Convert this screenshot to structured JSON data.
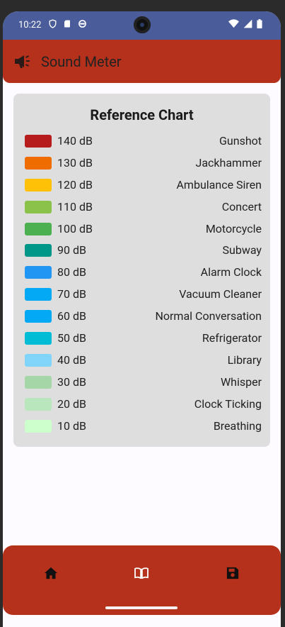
{
  "status": {
    "time": "10:22"
  },
  "app": {
    "title": "Sound Meter",
    "title_icon": "megaphone-icon"
  },
  "reference_chart": {
    "title": "Reference Chart",
    "items": [
      {
        "db": "140 dB",
        "source": "Gunshot",
        "color": "#b71c1c"
      },
      {
        "db": "130 dB",
        "source": "Jackhammer",
        "color": "#ef6c00"
      },
      {
        "db": "120 dB",
        "source": "Ambulance Siren",
        "color": "#ffc107"
      },
      {
        "db": "110 dB",
        "source": "Concert",
        "color": "#8bc34a"
      },
      {
        "db": "100 dB",
        "source": "Motorcycle",
        "color": "#4caf50"
      },
      {
        "db": "90 dB",
        "source": "Subway",
        "color": "#009688"
      },
      {
        "db": "80 dB",
        "source": "Alarm Clock",
        "color": "#2196f3"
      },
      {
        "db": "70 dB",
        "source": "Vacuum Cleaner",
        "color": "#03a9f4"
      },
      {
        "db": "60 dB",
        "source": "Normal Conversation",
        "color": "#03a9f4"
      },
      {
        "db": "50 dB",
        "source": "Refrigerator",
        "color": "#00bcd4"
      },
      {
        "db": "40 dB",
        "source": "Library",
        "color": "#81d4fa"
      },
      {
        "db": "30 dB",
        "source": "Whisper",
        "color": "#a5d6a7"
      },
      {
        "db": "20 dB",
        "source": "Clock Ticking",
        "color": "#b9e6bd"
      },
      {
        "db": "10 dB",
        "source": "Breathing",
        "color": "#ccffcc"
      }
    ]
  },
  "bottom_nav": {
    "items": [
      "home-icon",
      "book-icon",
      "save-icon"
    ]
  },
  "colors": {
    "status_bar": "#4a5d9a",
    "primary": "#b5311b",
    "card": "#dedede"
  }
}
